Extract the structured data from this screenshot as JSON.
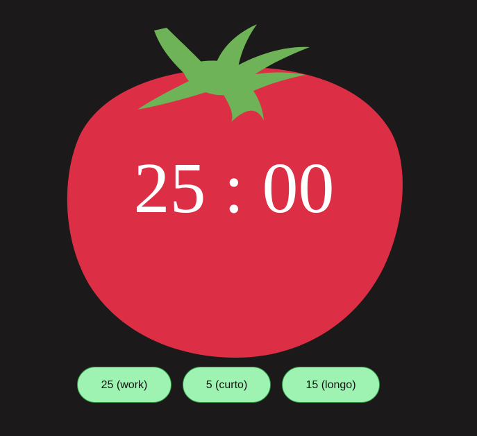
{
  "timer": {
    "minutes": "25",
    "separator": ":",
    "seconds": "00"
  },
  "buttons": {
    "work": "25 (work)",
    "short": "5 (curto)",
    "long": "15 (longo)"
  },
  "colors": {
    "background": "#1b191a",
    "tomato_body": "#dc2f45",
    "tomato_leaves": "#6eb357",
    "timer_text": "#ffffff",
    "button_fill": "#9ef3b2",
    "button_border": "#2f9a44"
  },
  "icons": {
    "tomato": "tomato-icon",
    "stem": "stem-icon"
  }
}
